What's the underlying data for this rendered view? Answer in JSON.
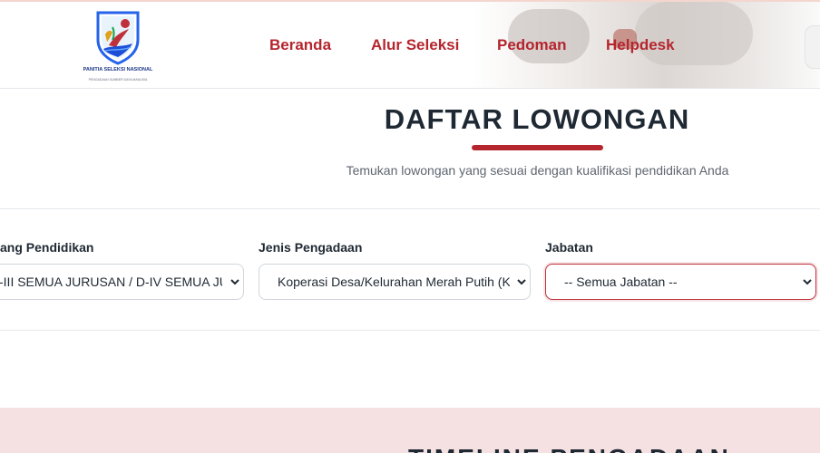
{
  "header": {
    "logo": {
      "icon": "committee-emblem-icon",
      "title": "PANITIA SELEKSI NASIONAL",
      "subtitle": "PENGADAAN SUMBER DAYA MANUSIA"
    },
    "nav": [
      {
        "label": "Beranda"
      },
      {
        "label": "Alur Seleksi"
      },
      {
        "label": "Pedoman"
      },
      {
        "label": "Helpdesk"
      }
    ]
  },
  "hero": {
    "title": "DAFTAR LOWONGAN",
    "subtitle": "Temukan lowongan yang sesuai dengan kualifikasi pendidikan Anda"
  },
  "filters": [
    {
      "label": "Jenjang Pendidikan",
      "visible_label": "ang Pendidikan",
      "value": "D-III SEMUA JURUSAN / D-IV SEMUA JURUSAN",
      "visible_value": "-III SEMUA JURUSAN / D-IV SEMUA JU"
    },
    {
      "label": "Jenis Pengadaan",
      "visible_label": "Jenis Pengadaan",
      "value": "Koperasi Desa/Kelurahan Merah Putih (KDKMP)",
      "visible_value": "Koperasi Desa/Kelurahan Merah Putih (KD"
    },
    {
      "label": "Jabatan",
      "visible_label": "Jabatan",
      "value": "-- Semua Jabatan --",
      "visible_value": "-- Semua Jabatan --"
    }
  ],
  "timeline": {
    "heading": "TIMELINE PENGADAAN"
  },
  "colors": {
    "brand_red": "#b5252e",
    "text_dark": "#1f2933",
    "muted": "#5f6670",
    "band_bg": "#f5e1e2"
  }
}
